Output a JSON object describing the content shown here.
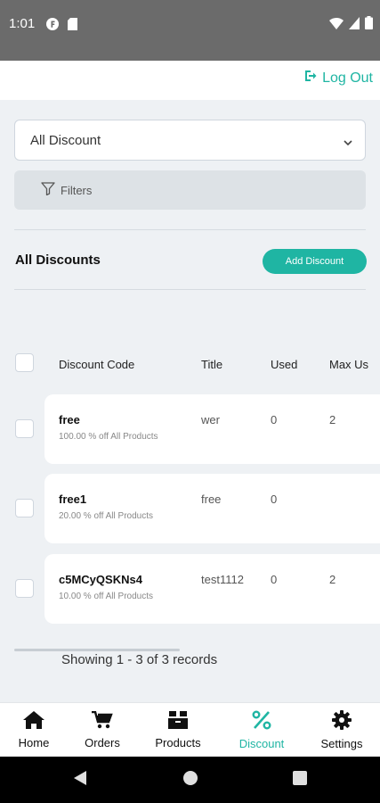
{
  "status_bar": {
    "time": "1:01",
    "left_icons": [
      "notification-f-icon",
      "sd-card-icon"
    ],
    "right_icons": [
      "wifi-icon",
      "signal-icon",
      "battery-icon"
    ]
  },
  "header": {
    "logout_label": "Log Out",
    "logout_icon": "logout-icon"
  },
  "filter": {
    "selected": "All Discount",
    "filters_label": "Filters"
  },
  "section": {
    "title": "All Discounts",
    "add_button": "Add Discount"
  },
  "table": {
    "columns": [
      "Discount Code",
      "Title",
      "Used",
      "Max Us"
    ],
    "rows": [
      {
        "code": "free",
        "description": "100.00 % off All Products",
        "title": "wer",
        "used": "0",
        "max": "2"
      },
      {
        "code": "free1",
        "description": "20.00 % off All Products",
        "title": "free",
        "used": "0",
        "max": ""
      },
      {
        "code": "c5MCyQSKNs4",
        "description": "10.00 % off All Products",
        "title": "test1112",
        "used": "0",
        "max": "2"
      }
    ]
  },
  "pagination": {
    "records_text": "Showing 1 - 3 of 3 records"
  },
  "bottom_nav": {
    "items": [
      {
        "label": "Home",
        "icon": "home-icon"
      },
      {
        "label": "Orders",
        "icon": "cart-icon"
      },
      {
        "label": "Products",
        "icon": "box-icon"
      },
      {
        "label": "Discount",
        "icon": "percent-icon",
        "active": true
      },
      {
        "label": "Settings",
        "icon": "gear-icon"
      }
    ]
  },
  "colors": {
    "accent": "#1fb5a3",
    "status_bar": "#6b6b6b",
    "background": "#eef1f4"
  }
}
